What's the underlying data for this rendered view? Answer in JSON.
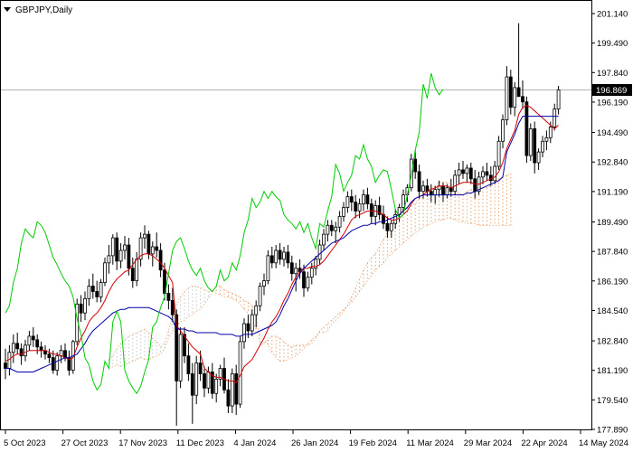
{
  "symbol_label": "GBPJPY,Daily",
  "current_price_label": "196.869",
  "colors": {
    "background": "#ffffff",
    "axis": "#000000",
    "tenkan": "#d40000",
    "kijun": "#0000aa",
    "chikou": "#00cc00",
    "kumo": "#e8a070",
    "kumo_alt": "#c8c8c8",
    "candle": "#000000",
    "price_line": "#b4b4b4",
    "price_tag": "#000000",
    "price_tag_text": "#ffffff"
  },
  "chart_data": {
    "type": "candlestick",
    "indicator": "Ichimoku Kinko Hyo",
    "ylim": [
      177.89,
      201.6
    ],
    "y_ticks": [
      "201.140",
      "199.490",
      "197.840",
      "196.190",
      "194.490",
      "192.840",
      "191.190",
      "189.490",
      "187.840",
      "186.190",
      "184.540",
      "182.840",
      "181.190",
      "179.540",
      "177.890"
    ],
    "x_ticks": [
      "5 Oct 2023",
      "27 Oct 2023",
      "17 Nov 2023",
      "11 Dec 2023",
      "4 Jan 2024",
      "26 Jan 2024",
      "19 Feb 2024",
      "11 Mar 2024",
      "29 Mar 2024",
      "22 Apr 2024",
      "14 May 2024"
    ],
    "current_price": 196.869,
    "ohlc": [
      [
        181.6,
        182.4,
        180.7,
        181.3
      ],
      [
        181.3,
        182.6,
        180.9,
        182.2
      ],
      [
        182.2,
        183.2,
        181.6,
        182.7
      ],
      [
        182.7,
        183.3,
        182.1,
        182.4
      ],
      [
        182.4,
        182.7,
        181.5,
        182.0
      ],
      [
        182.0,
        182.9,
        181.7,
        182.6
      ],
      [
        182.6,
        183.4,
        182.3,
        183.1
      ],
      [
        183.1,
        183.6,
        182.5,
        182.9
      ],
      [
        182.9,
        183.2,
        182.1,
        182.5
      ],
      [
        182.5,
        182.8,
        181.9,
        182.3
      ],
      [
        182.3,
        182.6,
        181.8,
        182.1
      ],
      [
        182.1,
        182.4,
        181.6,
        181.9
      ],
      [
        181.9,
        182.3,
        181.0,
        181.2
      ],
      [
        181.2,
        182.2,
        180.9,
        182.0
      ],
      [
        182.0,
        182.6,
        181.6,
        182.3
      ],
      [
        182.3,
        182.7,
        181.7,
        181.9
      ],
      [
        181.9,
        182.3,
        180.9,
        181.2
      ],
      [
        181.2,
        182.9,
        181.0,
        182.8
      ],
      [
        182.8,
        185.2,
        182.6,
        184.9
      ],
      [
        184.9,
        185.4,
        183.9,
        184.4
      ],
      [
        184.4,
        185.6,
        184.0,
        185.2
      ],
      [
        185.2,
        186.3,
        184.8,
        185.9
      ],
      [
        185.9,
        186.6,
        185.2,
        185.6
      ],
      [
        185.6,
        186.2,
        185.0,
        185.3
      ],
      [
        185.3,
        186.3,
        185.0,
        186.1
      ],
      [
        186.1,
        187.5,
        185.9,
        187.2
      ],
      [
        187.2,
        188.2,
        186.6,
        187.6
      ],
      [
        187.6,
        188.8,
        187.1,
        188.6
      ],
      [
        188.6,
        188.9,
        186.8,
        187.3
      ],
      [
        187.3,
        188.3,
        186.9,
        187.9
      ],
      [
        187.9,
        188.7,
        187.4,
        188.2
      ],
      [
        188.2,
        188.6,
        186.5,
        186.9
      ],
      [
        186.9,
        187.5,
        185.8,
        186.2
      ],
      [
        186.2,
        187.8,
        185.9,
        187.4
      ],
      [
        187.4,
        188.9,
        187.0,
        188.6
      ],
      [
        188.6,
        189.3,
        188.0,
        188.8
      ],
      [
        188.8,
        189.0,
        187.4,
        187.7
      ],
      [
        187.7,
        188.4,
        187.0,
        188.1
      ],
      [
        188.1,
        188.9,
        187.5,
        187.9
      ],
      [
        187.9,
        188.3,
        186.4,
        186.8
      ],
      [
        186.8,
        187.2,
        185.1,
        185.5
      ],
      [
        185.5,
        186.0,
        184.6,
        185.1
      ],
      [
        185.1,
        185.8,
        183.9,
        184.3
      ],
      [
        184.3,
        184.6,
        178.1,
        180.6
      ],
      [
        180.6,
        183.6,
        180.2,
        183.2
      ],
      [
        183.2,
        183.6,
        181.6,
        182.0
      ],
      [
        182.0,
        182.7,
        180.6,
        181.0
      ],
      [
        181.0,
        181.6,
        178.2,
        179.8
      ],
      [
        179.8,
        182.0,
        179.3,
        181.6
      ],
      [
        181.6,
        182.3,
        180.6,
        181.0
      ],
      [
        181.0,
        181.4,
        179.7,
        180.2
      ],
      [
        180.2,
        181.4,
        179.9,
        181.1
      ],
      [
        181.1,
        181.6,
        179.6,
        179.9
      ],
      [
        179.9,
        181.0,
        179.4,
        180.7
      ],
      [
        180.7,
        181.5,
        180.3,
        181.3
      ],
      [
        181.3,
        181.9,
        179.9,
        180.1
      ],
      [
        180.1,
        180.7,
        178.8,
        179.2
      ],
      [
        179.2,
        181.3,
        178.8,
        181.0
      ],
      [
        181.0,
        181.5,
        178.7,
        179.3
      ],
      [
        179.3,
        183.1,
        179.1,
        182.8
      ],
      [
        182.8,
        184.1,
        182.4,
        183.8
      ],
      [
        183.8,
        184.3,
        183.0,
        183.4
      ],
      [
        183.4,
        184.6,
        183.1,
        184.3
      ],
      [
        184.3,
        185.1,
        183.6,
        184.8
      ],
      [
        184.8,
        186.1,
        184.5,
        185.9
      ],
      [
        185.9,
        186.6,
        185.4,
        186.2
      ],
      [
        186.2,
        187.9,
        186.0,
        187.6
      ],
      [
        187.6,
        188.1,
        186.9,
        187.2
      ],
      [
        187.2,
        188.2,
        186.9,
        187.9
      ],
      [
        187.9,
        188.3,
        187.1,
        187.4
      ],
      [
        187.4,
        188.1,
        187.0,
        187.8
      ],
      [
        187.8,
        188.2,
        186.9,
        187.2
      ],
      [
        187.2,
        187.6,
        186.2,
        186.6
      ],
      [
        186.6,
        187.2,
        185.6,
        186.9
      ],
      [
        186.9,
        187.4,
        186.3,
        186.7
      ],
      [
        186.7,
        187.1,
        185.3,
        185.8
      ],
      [
        185.8,
        186.7,
        185.6,
        186.4
      ],
      [
        186.4,
        187.2,
        186.0,
        186.9
      ],
      [
        186.9,
        187.6,
        186.5,
        187.4
      ],
      [
        187.4,
        188.5,
        187.1,
        188.2
      ],
      [
        188.2,
        189.1,
        187.9,
        188.8
      ],
      [
        188.8,
        189.6,
        188.4,
        189.3
      ],
      [
        189.3,
        189.6,
        188.7,
        189.0
      ],
      [
        189.0,
        189.5,
        188.3,
        189.2
      ],
      [
        189.2,
        190.1,
        188.9,
        189.8
      ],
      [
        189.8,
        190.6,
        189.5,
        190.3
      ],
      [
        190.3,
        191.2,
        190.0,
        190.9
      ],
      [
        190.9,
        191.3,
        190.1,
        190.6
      ],
      [
        190.6,
        191.0,
        189.7,
        190.1
      ],
      [
        190.1,
        190.8,
        189.7,
        190.5
      ],
      [
        190.5,
        191.3,
        190.1,
        191.0
      ],
      [
        191.0,
        191.4,
        190.2,
        190.5
      ],
      [
        190.5,
        190.8,
        189.4,
        189.8
      ],
      [
        189.8,
        190.7,
        189.3,
        190.4
      ],
      [
        190.4,
        190.9,
        189.6,
        189.9
      ],
      [
        189.9,
        190.4,
        189.1,
        189.4
      ],
      [
        189.4,
        189.8,
        188.6,
        189.0
      ],
      [
        189.0,
        189.6,
        188.6,
        189.4
      ],
      [
        189.4,
        190.2,
        189.1,
        189.9
      ],
      [
        189.9,
        190.5,
        189.5,
        190.3
      ],
      [
        190.3,
        191.3,
        190.0,
        191.0
      ],
      [
        191.0,
        191.6,
        190.6,
        191.4
      ],
      [
        191.4,
        193.3,
        191.2,
        193.0
      ],
      [
        193.0,
        193.5,
        191.9,
        192.3
      ],
      [
        192.3,
        192.7,
        190.8,
        191.2
      ],
      [
        191.2,
        191.8,
        190.8,
        191.5
      ],
      [
        191.5,
        191.9,
        190.9,
        191.2
      ],
      [
        191.2,
        191.6,
        190.6,
        191.0
      ],
      [
        191.0,
        191.5,
        190.5,
        191.3
      ],
      [
        191.3,
        191.8,
        190.9,
        191.5
      ],
      [
        191.5,
        191.7,
        190.6,
        191.0
      ],
      [
        191.0,
        191.6,
        190.8,
        191.4
      ],
      [
        191.4,
        191.9,
        190.9,
        191.2
      ],
      [
        191.2,
        192.4,
        191.0,
        192.1
      ],
      [
        192.1,
        192.8,
        191.6,
        192.4
      ],
      [
        192.4,
        192.9,
        191.9,
        192.2
      ],
      [
        192.2,
        192.7,
        191.7,
        192.5
      ],
      [
        192.5,
        192.8,
        191.6,
        191.9
      ],
      [
        191.9,
        192.4,
        190.8,
        191.2
      ],
      [
        191.2,
        192.3,
        191.0,
        192.0
      ],
      [
        192.0,
        192.6,
        191.6,
        192.3
      ],
      [
        192.3,
        192.8,
        191.8,
        192.1
      ],
      [
        192.1,
        192.6,
        191.5,
        191.8
      ],
      [
        191.8,
        192.9,
        191.6,
        192.6
      ],
      [
        192.6,
        194.3,
        192.4,
        194.0
      ],
      [
        194.0,
        195.5,
        193.6,
        195.2
      ],
      [
        195.2,
        198.2,
        194.9,
        197.6
      ],
      [
        197.6,
        198.0,
        195.5,
        195.9
      ],
      [
        195.9,
        197.3,
        195.4,
        197.0
      ],
      [
        197.0,
        200.6,
        196.6,
        196.5
      ],
      [
        196.5,
        197.4,
        195.8,
        196.2
      ],
      [
        196.2,
        196.5,
        192.8,
        193.2
      ],
      [
        193.2,
        195.0,
        192.9,
        194.7
      ],
      [
        194.7,
        195.1,
        192.2,
        192.8
      ],
      [
        192.8,
        193.6,
        192.4,
        193.4
      ],
      [
        193.4,
        194.3,
        193.1,
        194.0
      ],
      [
        194.0,
        194.6,
        193.5,
        194.2
      ],
      [
        194.2,
        195.1,
        193.9,
        194.8
      ],
      [
        194.8,
        196.1,
        194.6,
        195.8
      ],
      [
        195.8,
        197.1,
        195.5,
        196.869
      ]
    ],
    "tenkan_sen": [
      181.7,
      181.8,
      182.0,
      182.1,
      182.1,
      182.2,
      182.3,
      182.3,
      182.3,
      182.3,
      182.3,
      182.2,
      182.1,
      182.1,
      182.0,
      181.9,
      181.8,
      181.9,
      182.5,
      183.0,
      183.4,
      183.9,
      184.2,
      184.4,
      184.7,
      185.1,
      185.6,
      186.0,
      186.3,
      186.5,
      186.7,
      186.8,
      187.1,
      187.4,
      187.6,
      187.7,
      187.7,
      187.6,
      187.4,
      187.2,
      186.9,
      186.5,
      186.1,
      183.7,
      183.4,
      183.1,
      182.8,
      182.5,
      182.3,
      182.1,
      181.3,
      181.1,
      180.9,
      180.8,
      180.8,
      180.7,
      180.6,
      180.6,
      180.5,
      180.9,
      181.4,
      181.6,
      181.8,
      182.2,
      182.6,
      183.0,
      183.5,
      183.9,
      184.2,
      184.6,
      185.1,
      185.5,
      186.0,
      186.4,
      186.7,
      186.9,
      186.9,
      187.0,
      187.0,
      187.1,
      187.3,
      187.6,
      187.9,
      188.2,
      188.5,
      188.8,
      189.2,
      189.6,
      189.8,
      189.9,
      190.0,
      190.1,
      190.1,
      190.1,
      190.0,
      189.9,
      189.7,
      189.6,
      189.6,
      189.7,
      189.9,
      190.1,
      190.5,
      190.8,
      190.9,
      191.0,
      191.2,
      191.3,
      191.4,
      191.5,
      191.5,
      191.5,
      191.4,
      191.5,
      191.6,
      191.7,
      191.7,
      191.7,
      191.6,
      191.6,
      191.7,
      191.8,
      191.9,
      192.0,
      192.3,
      192.8,
      193.6,
      194.1,
      194.6,
      195.5,
      195.9,
      196.0,
      195.9,
      195.7,
      195.5,
      195.3,
      195.1,
      194.9,
      194.7,
      194.9
    ],
    "kijun_sen": [
      181.3,
      181.3,
      181.2,
      181.1,
      181.1,
      181.1,
      181.1,
      181.1,
      181.2,
      181.3,
      181.4,
      181.5,
      181.6,
      181.7,
      181.8,
      181.9,
      181.9,
      182.0,
      182.1,
      182.4,
      182.7,
      183.1,
      183.4,
      183.6,
      183.8,
      184.0,
      184.2,
      184.4,
      184.5,
      184.6,
      184.6,
      184.7,
      184.7,
      184.7,
      184.7,
      184.7,
      184.7,
      184.6,
      184.5,
      184.4,
      184.3,
      184.2,
      184.0,
      183.5,
      183.5,
      183.5,
      183.4,
      183.4,
      183.3,
      183.3,
      183.3,
      183.3,
      183.3,
      183.3,
      183.2,
      183.2,
      183.2,
      183.2,
      183.1,
      183.1,
      183.2,
      183.2,
      183.2,
      183.3,
      183.4,
      183.5,
      183.6,
      183.7,
      183.9,
      184.3,
      184.8,
      185.2,
      185.7,
      186.2,
      186.6,
      186.9,
      187.1,
      187.3,
      187.5,
      187.7,
      187.9,
      188.1,
      188.3,
      188.4,
      188.5,
      188.6,
      188.8,
      189.0,
      189.1,
      189.2,
      189.3,
      189.3,
      189.4,
      189.4,
      189.5,
      189.5,
      189.6,
      189.7,
      189.8,
      189.9,
      190.1,
      190.3,
      190.6,
      190.8,
      190.9,
      191.0,
      191.0,
      191.0,
      191.0,
      191.0,
      191.0,
      191.0,
      191.0,
      191.0,
      191.0,
      191.0,
      191.1,
      191.1,
      191.2,
      191.3,
      191.4,
      191.5,
      191.6,
      191.7,
      191.8,
      192.0,
      193.4,
      193.9,
      194.4,
      195.0,
      195.4,
      195.4,
      195.4,
      195.4,
      195.4,
      195.4,
      195.4,
      195.4,
      195.4,
      195.4
    ],
    "chikou_span": [
      184.4,
      184.8,
      186.1,
      186.9,
      188.3,
      189.1,
      188.8,
      188.6,
      189.5,
      189.3,
      188.9,
      188.2,
      187.5,
      187.1,
      186.6,
      186.2,
      185.9,
      185.3,
      184.1,
      183.2,
      181.9,
      181.5,
      180.6,
      180.1,
      180.4,
      181.7,
      181.3,
      183.9,
      184.5,
      183.9,
      181.2,
      180.6,
      180.2,
      179.9,
      180.3,
      181.1,
      181.8,
      183.6,
      183.9,
      184.7,
      185.3,
      186.6,
      187.9,
      188.4,
      188.6,
      188.0,
      187.3,
      186.8,
      186.5,
      186.9,
      186.2,
      185.8,
      185.6,
      185.9,
      186.8,
      186.2,
      186.4,
      187.2,
      186.8,
      187.6,
      188.9,
      189.6,
      190.8,
      190.3,
      190.6,
      191.2,
      190.8,
      191.2,
      190.9,
      190.7,
      189.9,
      189.6,
      189.4,
      189.1,
      189.5,
      188.9,
      189.4,
      188.6,
      188.0,
      189.4,
      189.2,
      190.1,
      190.9,
      192.7,
      192.2,
      191.2,
      191.7,
      192.1,
      193.2,
      193.0,
      193.8,
      193.0,
      192.6,
      191.7,
      192.1,
      192.4,
      192.3,
      191.3,
      190.2,
      189.7,
      189.9,
      191.0,
      192.1,
      193.5,
      194.5,
      197.2,
      196.4,
      197.8,
      197.0,
      196.6,
      196.9
    ],
    "senkou_a": [
      181.3,
      181.4,
      181.5,
      181.4,
      181.5,
      181.6,
      181.7,
      181.8,
      181.9,
      181.8,
      181.8,
      181.9,
      182.0,
      182.1,
      182.4,
      183.0,
      183.4,
      183.7,
      183.9,
      184.0,
      184.2,
      184.3,
      184.5,
      184.6,
      184.9,
      185.2,
      185.6,
      185.9,
      185.9,
      185.7,
      185.6,
      185.5,
      185.4,
      185.3,
      185.1,
      185.0,
      184.8,
      184.4,
      182.6,
      182.7,
      182.9,
      183.1,
      183.1,
      183.0,
      182.8,
      182.6,
      182.5,
      182.6,
      182.6,
      182.6,
      182.6,
      182.7,
      183.0,
      183.3,
      183.3,
      183.4,
      183.8,
      184.0,
      184.2,
      184.5,
      184.8,
      185.3,
      185.8,
      186.3,
      186.8,
      187.2,
      187.5,
      187.7,
      188.1,
      188.5,
      188.9,
      189.3,
      189.6,
      189.9,
      190.2,
      190.3,
      190.4,
      190.5,
      190.8,
      191.0,
      191.2,
      191.4,
      191.5,
      191.7,
      191.7,
      191.7,
      191.6,
      191.3,
      191.1,
      191.0,
      191.2,
      191.3,
      191.4,
      191.4,
      191.4,
      191.4,
      191.5,
      191.7,
      191.9,
      192.0,
      192.1,
      192.2
    ],
    "senkou_b": [
      181.8,
      182.0,
      182.4,
      182.7,
      182.9,
      183.1,
      183.2,
      183.3,
      183.4,
      183.5,
      183.3,
      183.0,
      182.8,
      182.5,
      182.7,
      183.4,
      184.2,
      184.9,
      185.3,
      185.6,
      185.8,
      185.9,
      185.9,
      185.8,
      185.7,
      185.6,
      185.6,
      185.5,
      185.4,
      185.3,
      185.3,
      185.2,
      185.1,
      184.9,
      184.6,
      184.4,
      184.0,
      183.5,
      183.2,
      183.0,
      182.6,
      182.2,
      181.9,
      181.7,
      181.7,
      181.8,
      181.9,
      182.0,
      182.2,
      182.4,
      182.7,
      182.9,
      183.1,
      183.4,
      183.6,
      183.8,
      184.0,
      184.2,
      184.4,
      184.6,
      184.8,
      185.0,
      185.3,
      185.6,
      185.9,
      186.2,
      186.5,
      186.8,
      187.0,
      187.2,
      187.5,
      187.7,
      187.9,
      188.1,
      188.3,
      188.5,
      188.7,
      188.9,
      189.0,
      189.2,
      189.3,
      189.4,
      189.5,
      189.6,
      189.6,
      189.7,
      189.7,
      189.6,
      189.5,
      189.5,
      189.4,
      189.4,
      189.4,
      189.3,
      189.3,
      189.3,
      189.3,
      189.3,
      189.3,
      189.3,
      189.3,
      189.3
    ]
  }
}
